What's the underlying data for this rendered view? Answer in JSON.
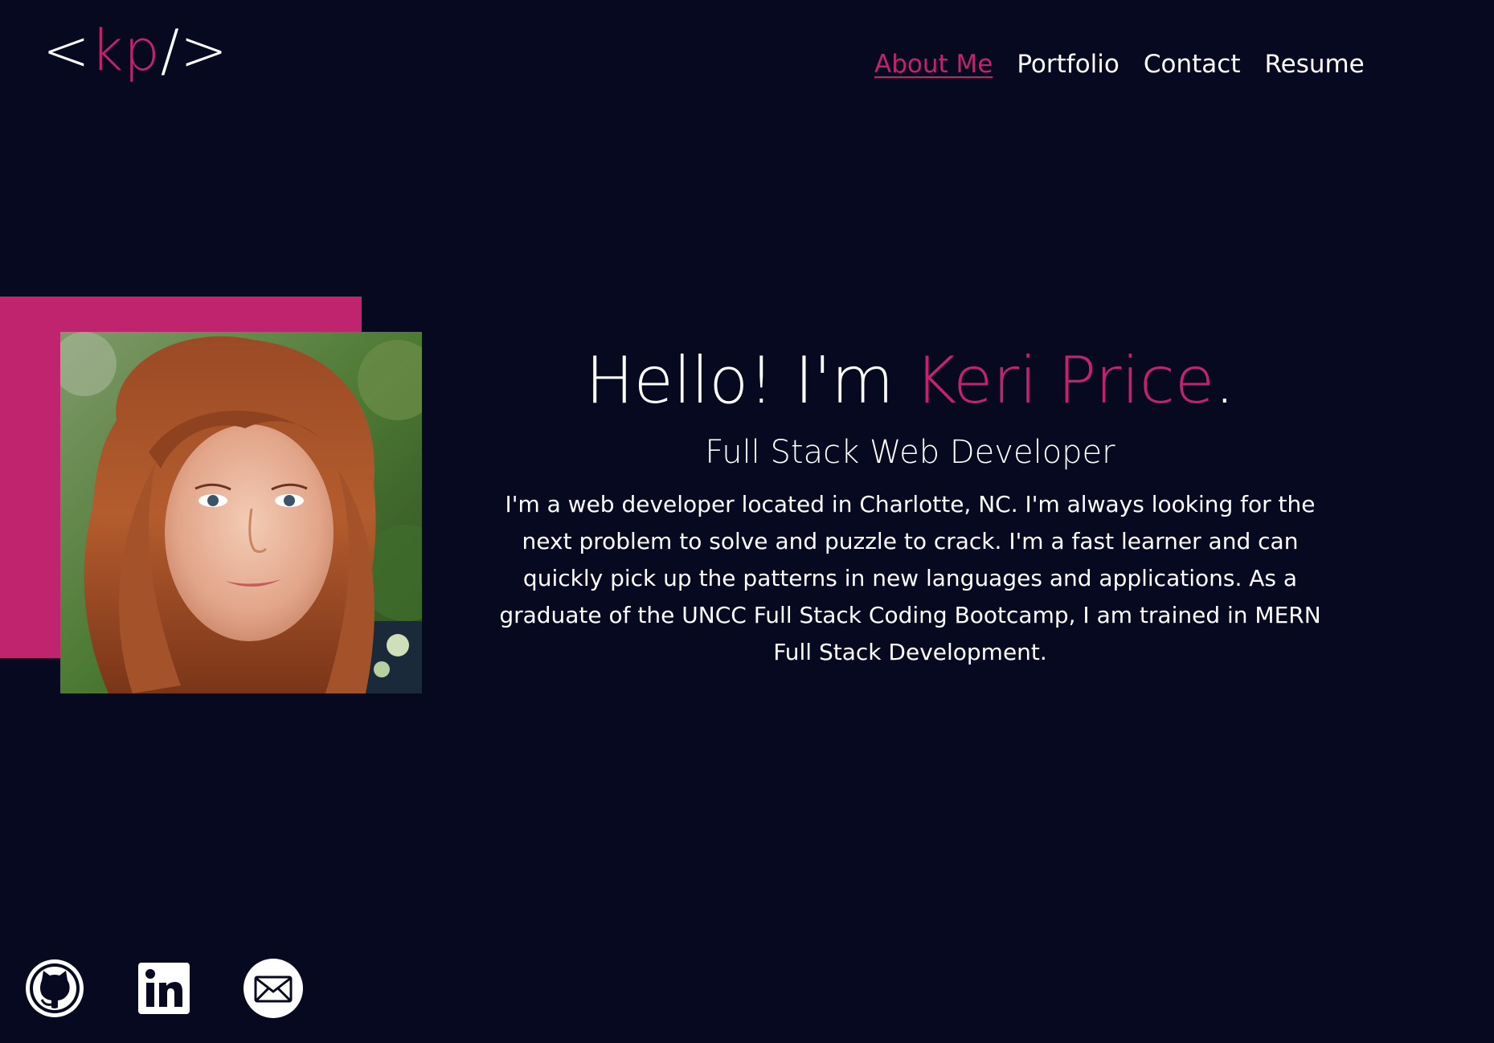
{
  "logo": {
    "open": "<",
    "initials": "kp",
    "close": "/>"
  },
  "nav": {
    "items": [
      {
        "label": "About Me",
        "active": true
      },
      {
        "label": "Portfolio",
        "active": false
      },
      {
        "label": "Contact",
        "active": false
      },
      {
        "label": "Resume",
        "active": false
      }
    ]
  },
  "hero": {
    "greeting": "Hello! I'm ",
    "name": "Keri Price",
    "period": ".",
    "subtitle": "Full Stack Web Developer",
    "bio": "I'm a web developer located in Charlotte, NC. I'm always looking for the next problem to solve and puzzle to crack. I'm a fast learner and can quickly pick up the patterns in new languages and applications. As a graduate of the UNCC Full Stack Coding Bootcamp, I am trained in MERN Full Stack Development."
  },
  "socials": [
    {
      "icon": "github-icon"
    },
    {
      "icon": "linkedin-icon"
    },
    {
      "icon": "email-icon"
    }
  ],
  "colors": {
    "background": "#070921",
    "accent": "#c0246f",
    "text": "#ffffff"
  }
}
